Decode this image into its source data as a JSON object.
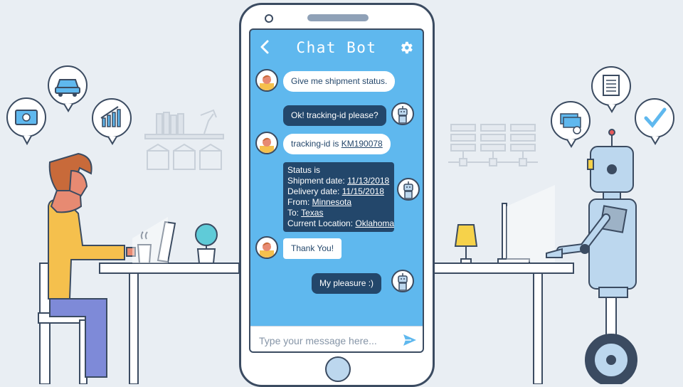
{
  "chat": {
    "title": "Chat Bot",
    "input_placeholder": "Type your message here...",
    "messages": [
      {
        "from": "user",
        "text": "Give me shipment status."
      },
      {
        "from": "bot",
        "text": "Ok! tracking-id please?"
      },
      {
        "from": "user",
        "text_prefix": "tracking-id is ",
        "tracking_id": "KM190078"
      },
      {
        "from": "bot",
        "status": {
          "heading": "Status is",
          "shipment_label": "Shipment date: ",
          "shipment_date": "11/13/2018",
          "delivery_label": "Delivery date: ",
          "delivery_date": "11/15/2018",
          "from_label": "From: ",
          "from": "Minnesota",
          "to_label": "To: ",
          "to": "Texas",
          "location_label": "Current Location: ",
          "location": "Oklahoma"
        }
      },
      {
        "from": "user",
        "text": "Thank You!"
      },
      {
        "from": "bot",
        "text": "My pleasure :)"
      }
    ]
  },
  "icons": {
    "left_bubbles": [
      "money-icon",
      "car-icon",
      "chart-icon"
    ],
    "right_bubbles": [
      "cash-icon",
      "document-icon",
      "check-icon"
    ],
    "header": [
      "back-icon",
      "gear-icon"
    ],
    "input": [
      "send-icon"
    ]
  },
  "colors": {
    "screen": "#5fb8ee",
    "bot_bubble": "#23476b",
    "user_bubble": "#ffffff",
    "outline": "#3b4b61",
    "background": "#e9eef3"
  }
}
